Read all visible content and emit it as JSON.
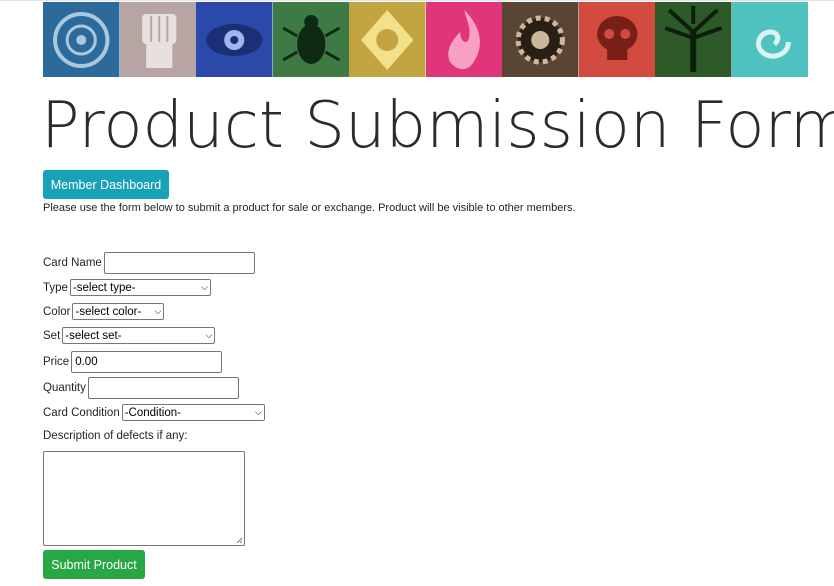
{
  "page": {
    "title": "Product Submission Form",
    "dashboard_button": "Member Dashboard",
    "intro": "Please use the form below to submit a product for sale or exchange. Product will be visible to other members."
  },
  "banner": {
    "tiles": [
      {
        "icon": "circular-emblem",
        "color": "#2d6a9c"
      },
      {
        "icon": "fist",
        "color": "#b6a5a2"
      },
      {
        "icon": "eye",
        "color": "#2b49a8"
      },
      {
        "icon": "beetle",
        "color": "#3e7a43"
      },
      {
        "icon": "sun-diamond",
        "color": "#c2a541"
      },
      {
        "icon": "flame",
        "color": "#e0357a"
      },
      {
        "icon": "gear",
        "color": "#5a4433"
      },
      {
        "icon": "skull",
        "color": "#d34a3e"
      },
      {
        "icon": "tree",
        "color": "#2e5a2a"
      },
      {
        "icon": "swirl",
        "color": "#4fc1bf"
      }
    ]
  },
  "form": {
    "card_name": {
      "label": "Card Name",
      "value": ""
    },
    "type": {
      "label": "Type",
      "selected": "-select type-"
    },
    "color": {
      "label": "Color",
      "selected": "-select color-"
    },
    "set": {
      "label": "Set",
      "selected": "-select set-"
    },
    "price": {
      "label": "Price",
      "value": "0.00"
    },
    "quantity": {
      "label": "Quantity",
      "value": ""
    },
    "condition": {
      "label": "Card Condition",
      "selected": "-Condition-"
    },
    "description": {
      "label": "Description of defects if any:",
      "value": ""
    },
    "submit_label": "Submit Product"
  },
  "colors": {
    "info": "#17a2b8",
    "success": "#28a745"
  }
}
